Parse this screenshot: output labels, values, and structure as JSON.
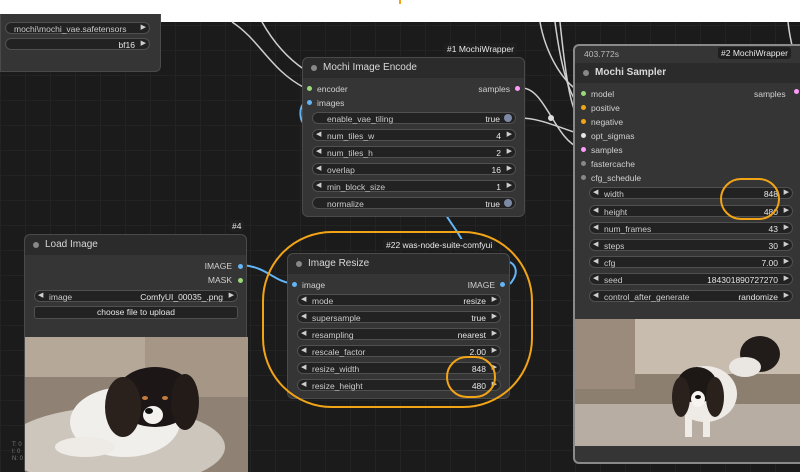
{
  "top_left_node": {
    "vae_value": "mochi\\mochi_vae.safetensors",
    "dtype_value": "bf16"
  },
  "encode_node": {
    "badge": "#1 MochiWrapper",
    "title": "Mochi Image Encode",
    "inputs": [
      "encoder",
      "images"
    ],
    "output": "samples",
    "widgets": [
      {
        "label": "enable_vae_tiling",
        "value": "true"
      },
      {
        "label": "num_tiles_w",
        "value": "4"
      },
      {
        "label": "num_tiles_h",
        "value": "2"
      },
      {
        "label": "overlap",
        "value": "16"
      },
      {
        "label": "min_block_size",
        "value": "1"
      },
      {
        "label": "normalize",
        "value": "true"
      }
    ]
  },
  "load_node": {
    "badge": "#4",
    "title": "Load Image",
    "outputs": [
      "IMAGE",
      "MASK"
    ],
    "image_label": "image",
    "image_value": "ComfyUI_00035_.png",
    "upload_label": "choose file to upload"
  },
  "resize_node": {
    "badge": "#22 was-node-suite-comfyui",
    "title": "Image Resize",
    "input": "image",
    "output": "IMAGE",
    "widgets": [
      {
        "label": "mode",
        "value": "resize"
      },
      {
        "label": "supersample",
        "value": "true"
      },
      {
        "label": "resampling",
        "value": "nearest"
      },
      {
        "label": "rescale_factor",
        "value": "2.00"
      },
      {
        "label": "resize_width",
        "value": "848"
      },
      {
        "label": "resize_height",
        "value": "480"
      }
    ]
  },
  "sampler_node": {
    "timer": "403.772s",
    "badge": "#2 MochiWrapper",
    "title": "Mochi Sampler",
    "inputs": [
      "model",
      "positive",
      "negative",
      "opt_sigmas",
      "samples",
      "fastercache",
      "cfg_schedule"
    ],
    "output": "samples",
    "widgets": [
      {
        "label": "width",
        "value": "848"
      },
      {
        "label": "height",
        "value": "480"
      },
      {
        "label": "num_frames",
        "value": "43"
      },
      {
        "label": "steps",
        "value": "30"
      },
      {
        "label": "cfg",
        "value": "7.00"
      },
      {
        "label": "seed",
        "value": "184301890727270"
      },
      {
        "label": "control_after_generate",
        "value": "randomize"
      }
    ]
  },
  "colors": {
    "annotation": "#f2a417",
    "latent_link": "#ff9cf9",
    "image_link": "#64b5f6"
  }
}
